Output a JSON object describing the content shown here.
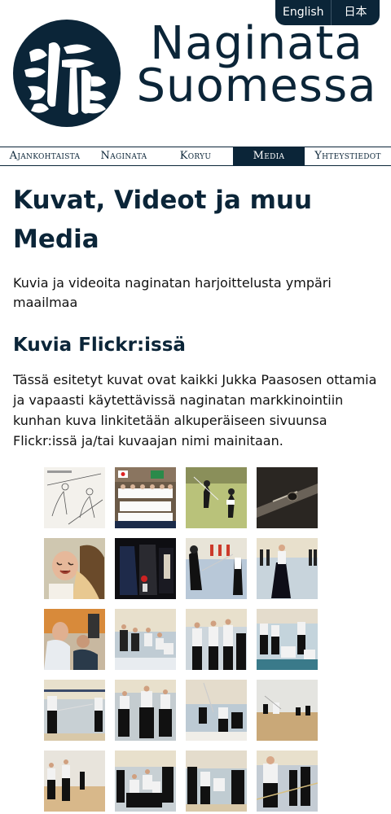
{
  "language_switcher": {
    "english": "English",
    "japanese": "日本語"
  },
  "site": {
    "title_line1": "Naginata",
    "title_line2": "Suomessa"
  },
  "nav": [
    {
      "label": "Ajankohtaista",
      "active": false
    },
    {
      "label": "Naginata",
      "active": false
    },
    {
      "label": "Koryu",
      "active": false
    },
    {
      "label": "Media",
      "active": true
    },
    {
      "label": "Yhteystiedot",
      "active": false
    }
  ],
  "page": {
    "title": "Kuvat, Videot ja muu Media",
    "intro": "Kuvia ja videoita naginatan harjoittelusta ympäri maailmaa",
    "section_title": "Kuvia Flickr:issä",
    "section_text": "Tässä esitetyt kuvat ovat kaikki Jukka Paasosen ottamia ja vapaasti käytettävissä naginatan markkinointiin kunhan kuva linkitetään alkuperäiseen sivuunsa Flickr:issä ja/tai kuvaajan nimi mainitaan."
  },
  "gallery": {
    "rows": 5,
    "cols": 4,
    "thumbnails": [
      "sketch",
      "group-photo",
      "gym-match",
      "blade-closeup",
      "baby-portrait",
      "bogu-armor",
      "bogu-practice",
      "gym-kata",
      "instructor-closeup",
      "gym-group",
      "gym-lineup",
      "gym-demo",
      "gym-hakama",
      "gym-hakama-2",
      "naginata-raised",
      "gym-wide",
      "gym-pair",
      "gym-line",
      "gym-crowd",
      "gym-demo-2"
    ]
  },
  "colors": {
    "brand": "#0b2538",
    "text": "#111111",
    "background": "#ffffff"
  }
}
